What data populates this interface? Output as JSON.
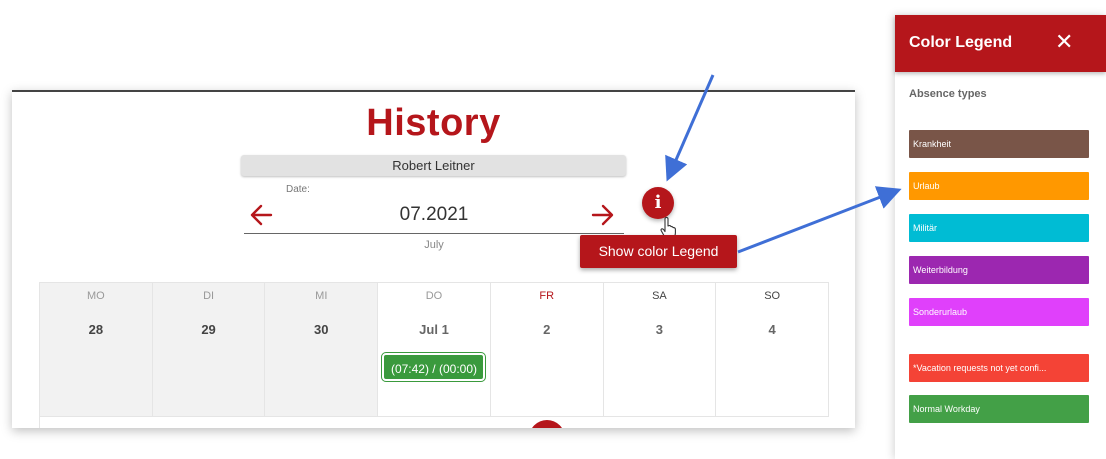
{
  "app": {
    "title": "History",
    "user": "Robert Leitner",
    "date_label": "Date:",
    "date_value": "07.2021",
    "month": "July",
    "info_glyph": "i",
    "tooltip": "Show color Legend",
    "accent_color": "#b5161b"
  },
  "calendar": {
    "days": [
      {
        "head": "MO",
        "num": "28"
      },
      {
        "head": "DI",
        "num": "29"
      },
      {
        "head": "MI",
        "num": "30"
      },
      {
        "head": "DO",
        "num": "Jul 1"
      },
      {
        "head": "FR",
        "num": "2"
      },
      {
        "head": "SA",
        "num": "3"
      },
      {
        "head": "SO",
        "num": "4"
      }
    ],
    "event": {
      "label": "(07:42) / (00:00)",
      "color": "#3a9a3d"
    }
  },
  "legend": {
    "title": "Color Legend",
    "close_glyph": "✕",
    "subtitle": "Absence types",
    "items": [
      {
        "label": "Krankheit",
        "color": "#795548"
      },
      {
        "label": "Urlaub",
        "color": "#ff9800"
      },
      {
        "label": "Militär",
        "color": "#00bcd4"
      },
      {
        "label": "Weiterbildung",
        "color": "#9c27b0"
      },
      {
        "label": "Sonderurlaub",
        "color": "#e040fb"
      },
      {
        "label": "*Vacation requests not yet confi...",
        "color": "#f44336"
      },
      {
        "label": "Normal Workday",
        "color": "#43a047"
      }
    ]
  },
  "icons": {
    "prev": "arrow-left-icon",
    "next": "arrow-right-icon",
    "info": "info-icon",
    "cursor": "hand-pointer-icon",
    "close": "close-icon"
  }
}
